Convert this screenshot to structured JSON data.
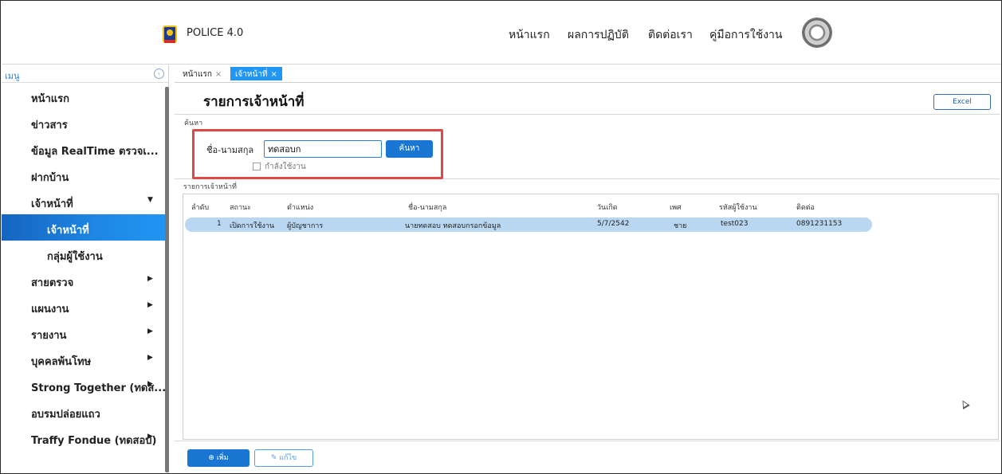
{
  "header": {
    "app_title": "POLICE 4.0",
    "nav": [
      "หน้าแรก",
      "ผลการปฏิบัติ",
      "ติดต่อเรา",
      "คู่มือการใช้งาน"
    ]
  },
  "sidebar": {
    "label": "เมนู",
    "items": [
      {
        "label": "หน้าแรก"
      },
      {
        "label": "ข่าวสาร"
      },
      {
        "label": "ข้อมูล RealTime ตรวจเ..."
      },
      {
        "label": "ฝากบ้าน"
      },
      {
        "label": "เจ้าหน้าที่"
      },
      {
        "label": "เจ้าหน้าที่"
      },
      {
        "label": "กลุ่มผู้ใช้งาน"
      },
      {
        "label": "สายตรวจ"
      },
      {
        "label": "แผนงาน"
      },
      {
        "label": "รายงาน"
      },
      {
        "label": "บุคคลพ้นโทษ"
      },
      {
        "label": "Strong Together (ทดส..."
      },
      {
        "label": "อบรมปล่อยแถว"
      },
      {
        "label": "Traffy Fondue (ทดสอบ)"
      }
    ]
  },
  "tabs": [
    {
      "label": "หน้าแรก",
      "close": "×"
    },
    {
      "label": "เจ้าหน้าที่",
      "close": "×"
    }
  ],
  "page": {
    "title": "รายการเจ้าหน้าที่",
    "excel_label": "Excel",
    "search_caption": "ค้นหา",
    "field_label": "ชื่อ-นามสกุล",
    "search_value": "ทดสอบก",
    "search_button": "ค้นหา",
    "checkbox_label": "กำลังใช้งาน",
    "list_caption": "รายการเจ้าหน้าที่"
  },
  "table": {
    "columns": [
      "ลำดับ",
      "สถานะ",
      "ตำแหน่ง",
      "ชื่อ-นามสกุล",
      "วันเกิด",
      "เพศ",
      "รหัสผู้ใช้งาน",
      "ติดต่อ"
    ],
    "rows": [
      [
        "1",
        "เปิดการใช้งาน",
        "ผู้บัญชาการ",
        "นายทดสอบ ทดสอบกรอกข้อมูล",
        "5/7/2542",
        "ชาย",
        "test023",
        "0891231153"
      ]
    ]
  },
  "footer": {
    "add_label": "⊕ เพิ่ม",
    "edit_label": "✎ แก้ไข"
  },
  "colors": {
    "accent": "#1976d2",
    "active_menu": "#1e88e5",
    "highlight_box": "#e04848",
    "selected_row": "#b9d7f1"
  }
}
